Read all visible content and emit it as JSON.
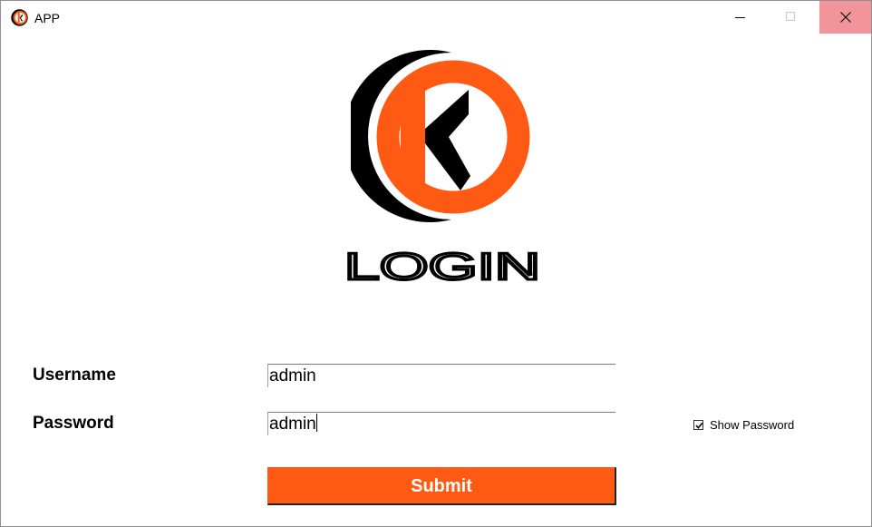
{
  "window": {
    "title": "APP",
    "close_hover_color": "#f1959b"
  },
  "logo": {
    "text": "LOGIN",
    "icon": "k-letter-logo-icon",
    "brand_color": "#ff5a14",
    "dark_color": "#000000"
  },
  "form": {
    "username": {
      "label": "Username",
      "value": "admin"
    },
    "password": {
      "label": "Password",
      "value": "admin"
    },
    "show_password": {
      "label": "Show Password",
      "checked": true
    },
    "submit_label": "Submit"
  }
}
